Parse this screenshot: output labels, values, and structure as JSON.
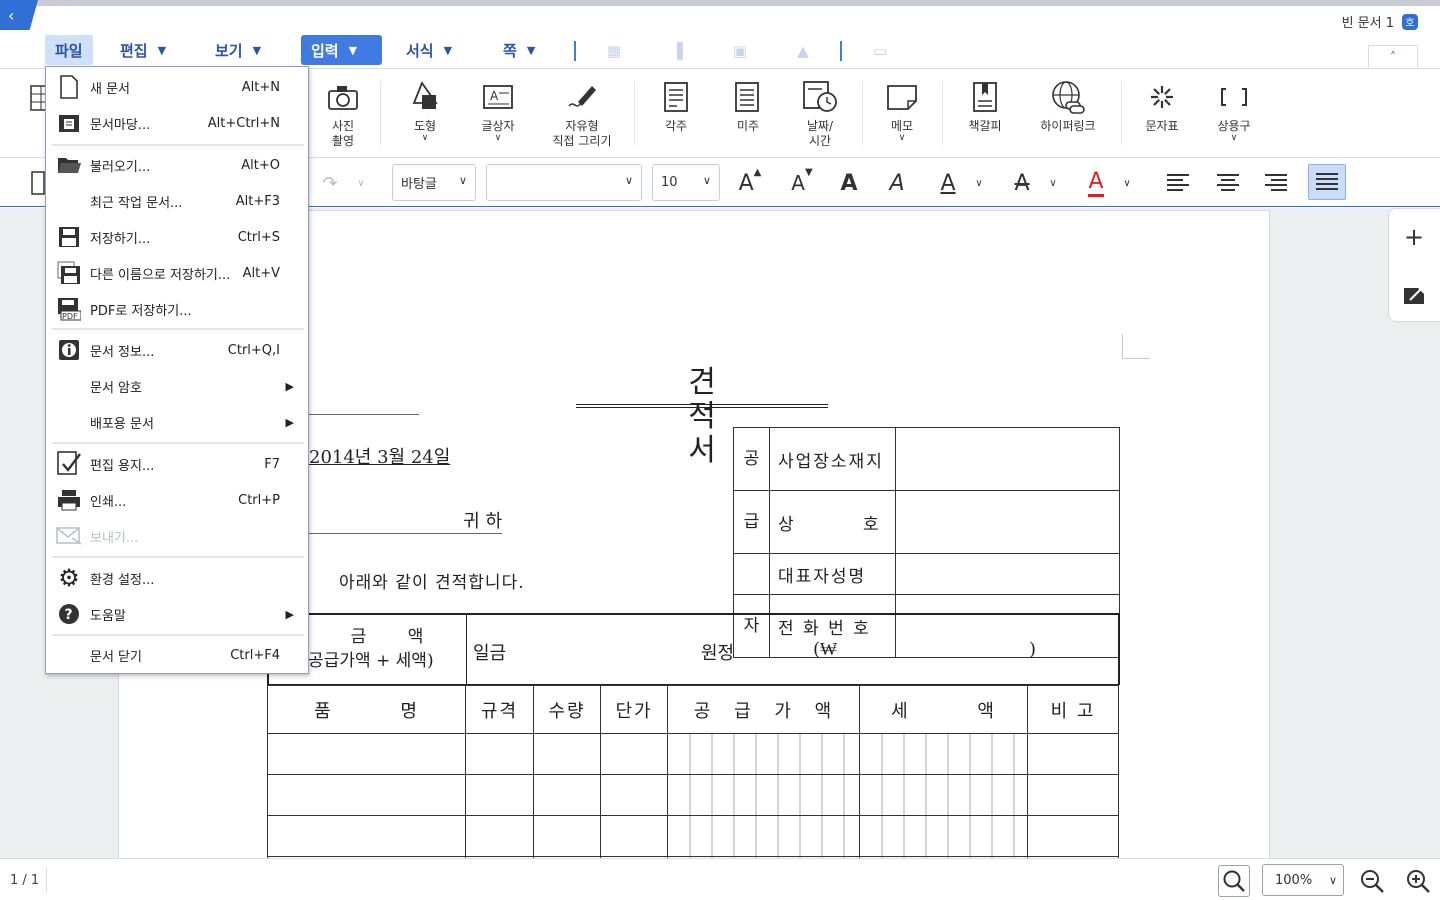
{
  "header": {
    "doc_title": "빈 문서 1",
    "doc_badge": "호"
  },
  "menubar": {
    "tabs": [
      {
        "label": "파일",
        "state": "open"
      },
      {
        "label": "편집"
      },
      {
        "label": "보기"
      },
      {
        "label": "입력",
        "state": "selected"
      },
      {
        "label": "서식"
      },
      {
        "label": "쪽"
      }
    ],
    "disabled_icons": [
      "table-icon",
      "chart-icon",
      "image-frame-icon",
      "shapes-icon",
      "window-icon"
    ]
  },
  "ribbon": {
    "items": [
      {
        "label": "사진\n촬영",
        "icon": "camera-icon"
      },
      {
        "label": "도형",
        "icon": "shape-icon",
        "dropdown": true
      },
      {
        "label": "글상자",
        "icon": "textbox-icon",
        "dropdown": true
      },
      {
        "label": "자유형\n직접 그리기",
        "icon": "freehand-icon"
      },
      {
        "label": "각주",
        "icon": "footnote-icon"
      },
      {
        "label": "미주",
        "icon": "endnote-icon"
      },
      {
        "label": "날짜/\n시간",
        "icon": "datetime-icon",
        "dropdown": true
      },
      {
        "label": "메모",
        "icon": "memo-icon",
        "dropdown": true
      },
      {
        "label": "책갈피",
        "icon": "bookmark-icon"
      },
      {
        "label": "하이퍼링크",
        "icon": "hyperlink-icon"
      },
      {
        "label": "문자표",
        "icon": "symbol-icon"
      },
      {
        "label": "상용구",
        "icon": "bracket-icon",
        "dropdown": true
      }
    ]
  },
  "format": {
    "style_value": "바탕글",
    "font_value": "",
    "size_value": "10",
    "accent_color": "#2f6fd6",
    "font_color": "#e02020"
  },
  "file_menu": {
    "items": [
      {
        "label": "새 문서",
        "shortcut": "Alt+N",
        "icon": "new-document-icon"
      },
      {
        "label": "문서마당...",
        "shortcut": "Alt+Ctrl+N",
        "icon": "template-icon"
      },
      {
        "label": "불러오기...",
        "shortcut": "Alt+O",
        "icon": "open-folder-icon"
      },
      {
        "label": "최근 작업 문서...",
        "shortcut": "Alt+F3",
        "icon": ""
      },
      {
        "label": "저장하기...",
        "shortcut": "Ctrl+S",
        "icon": "save-icon"
      },
      {
        "label": "다른 이름으로 저장하기...",
        "shortcut": "Alt+V",
        "icon": "save-as-icon"
      },
      {
        "label": "PDF로 저장하기...",
        "shortcut": "",
        "icon": "pdf-icon"
      },
      {
        "label": "문서 정보...",
        "shortcut": "Ctrl+Q,I",
        "icon": "info-icon"
      },
      {
        "label": "문서 암호",
        "shortcut": "",
        "icon": "",
        "submenu": true
      },
      {
        "label": "배포용 문서",
        "shortcut": "",
        "icon": "",
        "submenu": true
      },
      {
        "label": "편집 용지...",
        "shortcut": "F7",
        "icon": "page-setup-icon"
      },
      {
        "label": "인쇄...",
        "shortcut": "Ctrl+P",
        "icon": "print-icon"
      },
      {
        "label": "보내기...",
        "shortcut": "",
        "icon": "mail-icon",
        "disabled": true
      },
      {
        "label": "환경 설정...",
        "shortcut": "",
        "icon": "gear-icon"
      },
      {
        "label": "도움말",
        "shortcut": "",
        "icon": "help-icon",
        "submenu": true
      },
      {
        "label": "문서 닫기",
        "shortcut": "Ctrl+F4",
        "icon": ""
      }
    ]
  },
  "document": {
    "title": "견적서",
    "date": "2014년 3월 24일",
    "recipient_suffix": "귀 하",
    "intro": "아래와 같이 견적합니다.",
    "supplier": {
      "side_labels": [
        "공",
        "급",
        "자"
      ],
      "rows": [
        "사업장소재지",
        "상 호",
        "대표자성명",
        "전 화 번 호"
      ]
    },
    "amount": {
      "label_line1": "계 금 액",
      "label_line2": "(공급가액 + 세액)",
      "prefix": "일금",
      "unit": "원정",
      "won_open": "(₩",
      "won_close": ")"
    },
    "items_header": [
      "품 명",
      "규격",
      "수량",
      "단가",
      "공 급 가 액",
      "세 액",
      "비 고"
    ]
  },
  "status": {
    "page": "1 / 1",
    "zoom": "100%"
  }
}
